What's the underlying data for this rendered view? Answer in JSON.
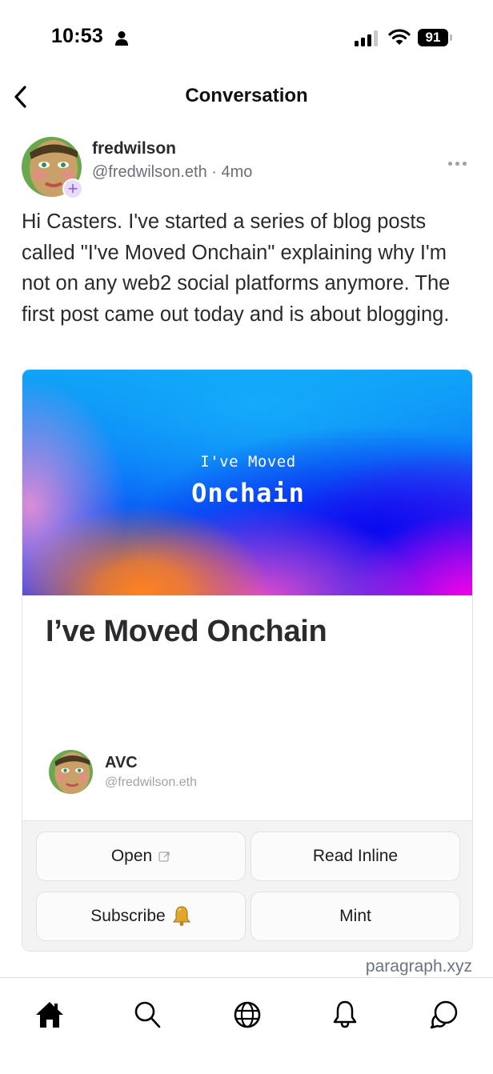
{
  "status_bar": {
    "time": "10:53",
    "battery": "91",
    "icons": [
      "person-icon",
      "signal-icon",
      "wifi-icon",
      "battery-icon"
    ]
  },
  "header": {
    "back_icon": "chevron-left-icon",
    "title": "Conversation"
  },
  "post": {
    "author_name": "fredwilson",
    "author_meta": "@fredwilson.eth · 4mo",
    "follow_badge": "+",
    "more_icon": "ellipsis-icon",
    "text": "Hi Casters. I've started a series of blog posts called \"I've Moved Onchain\" explaining why I'm not on any web2 social platforms anymore. The first post came out today and is about blogging."
  },
  "embed": {
    "image_subtitle": "I've Moved",
    "image_title": "Onchain",
    "title": "I’ve Moved Onchain",
    "author_name": "AVC",
    "author_handle": "@fredwilson.eth",
    "actions": [
      {
        "label": "Open",
        "icon": "external-link-icon"
      },
      {
        "label": "Read Inline"
      },
      {
        "label": "Subscribe",
        "icon": "bell-emoji"
      },
      {
        "label": "Mint"
      }
    ],
    "source": "paragraph.xyz"
  },
  "tab_bar": {
    "tabs": [
      {
        "name": "home",
        "icon": "home-icon",
        "active": true
      },
      {
        "name": "search",
        "icon": "search-icon",
        "active": false
      },
      {
        "name": "explore",
        "icon": "globe-icon",
        "active": false
      },
      {
        "name": "notifications",
        "icon": "bell-icon",
        "active": false
      },
      {
        "name": "messages",
        "icon": "chat-bubbles-icon",
        "active": false
      }
    ]
  }
}
